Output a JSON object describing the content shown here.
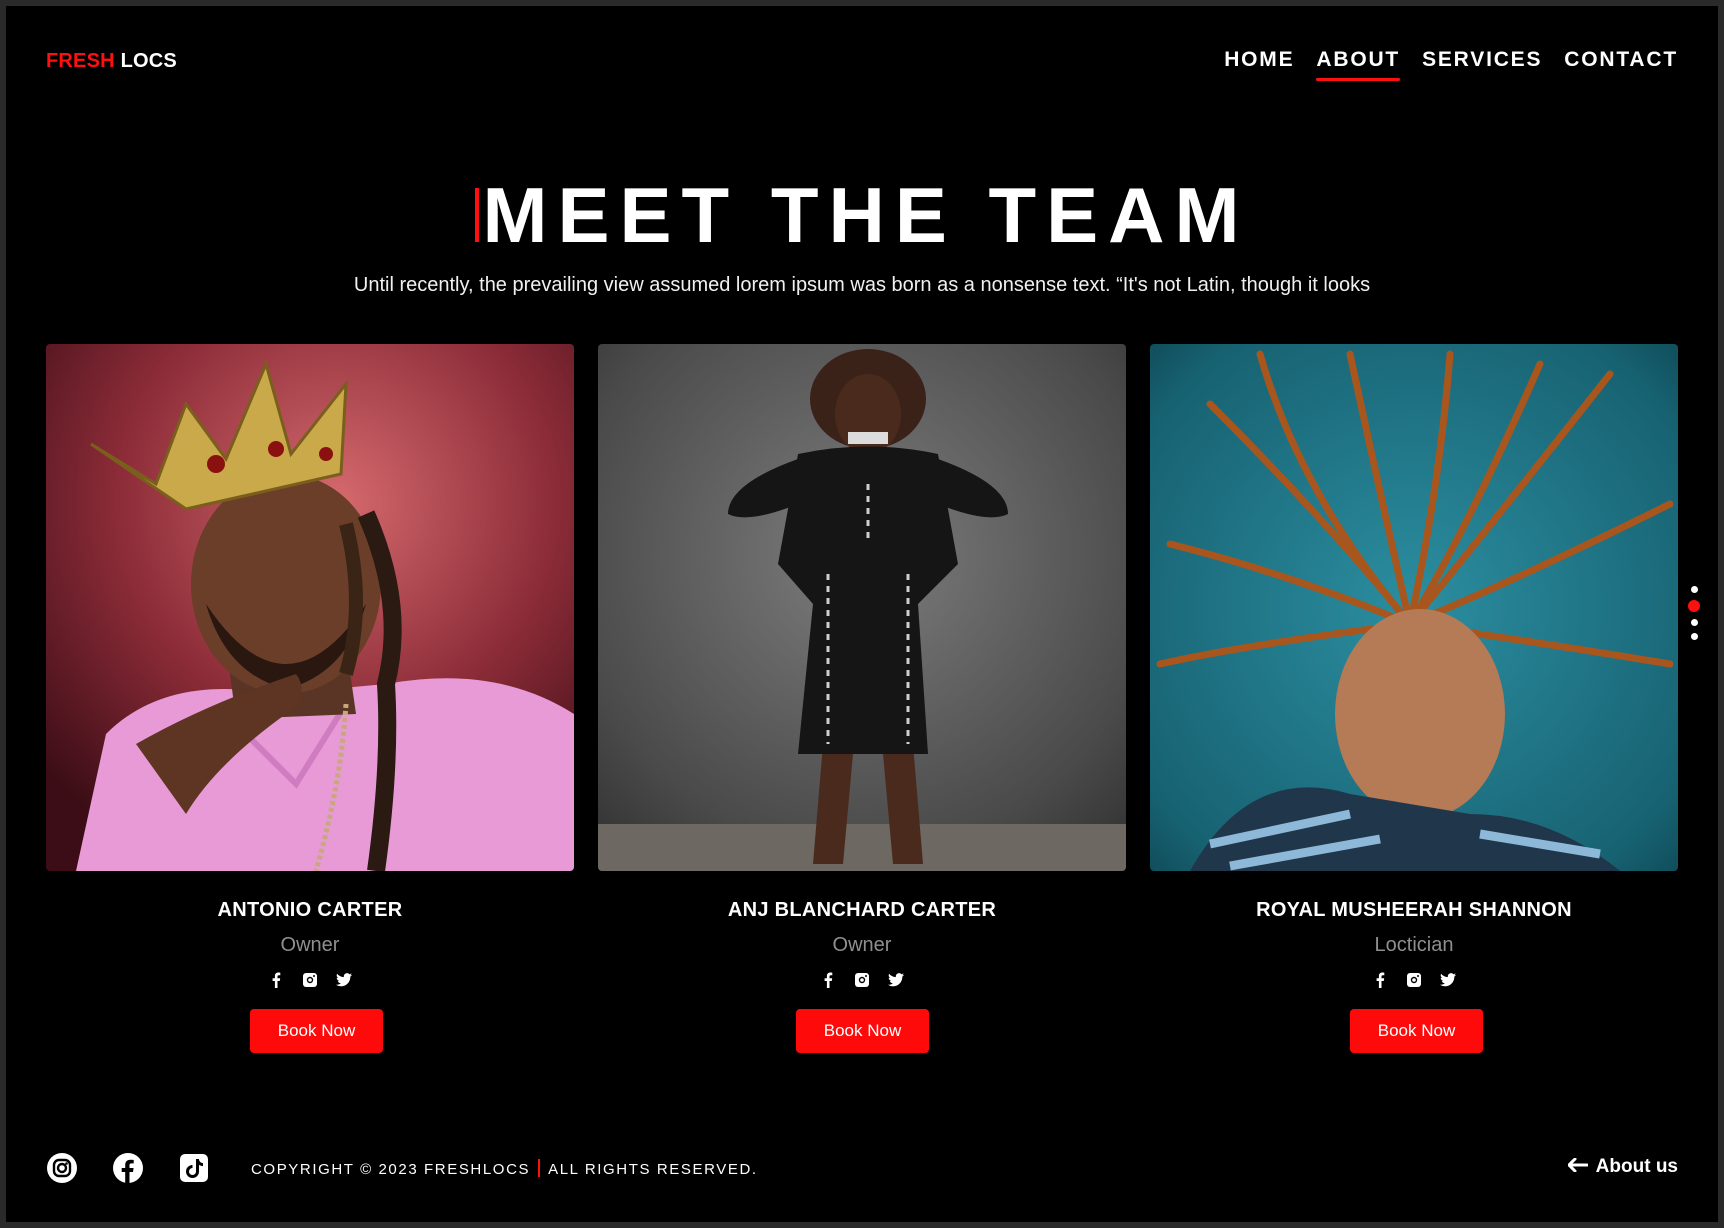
{
  "header": {
    "logo_red": "FRESH",
    "logo_white": "LOCS",
    "nav": [
      {
        "label": "HOME",
        "active": false
      },
      {
        "label": "ABOUT",
        "active": true
      },
      {
        "label": "SERVICES",
        "active": false
      },
      {
        "label": "CONTACT",
        "active": false
      }
    ]
  },
  "hero": {
    "title": "MEET THE TEAM",
    "subtitle": "Until recently, the prevailing view assumed lorem ipsum was born as a nonsense text. “It's not Latin, though it looks"
  },
  "team": [
    {
      "name": "ANTONIO CARTER",
      "role": "Owner",
      "button": "Book Now"
    },
    {
      "name": "ANJ BLANCHARD CARTER",
      "role": "Owner",
      "button": "Book Now"
    },
    {
      "name": "ROYAL MUSHEERAH SHANNON",
      "role": "Loctician",
      "button": "Book Now"
    }
  ],
  "pagination": {
    "count": 4,
    "active_index": 1
  },
  "footer": {
    "copyright_left": "COPYRIGHT © 2023 FRESHLOCS",
    "copyright_right": "ALL RIGHTS RESERVED.",
    "about_link": "About us",
    "social_icons": [
      "instagram-icon",
      "facebook-icon",
      "tiktok-icon"
    ]
  },
  "colors": {
    "accent": "#ff1010",
    "background": "#000000",
    "muted": "#8f8f8f"
  }
}
